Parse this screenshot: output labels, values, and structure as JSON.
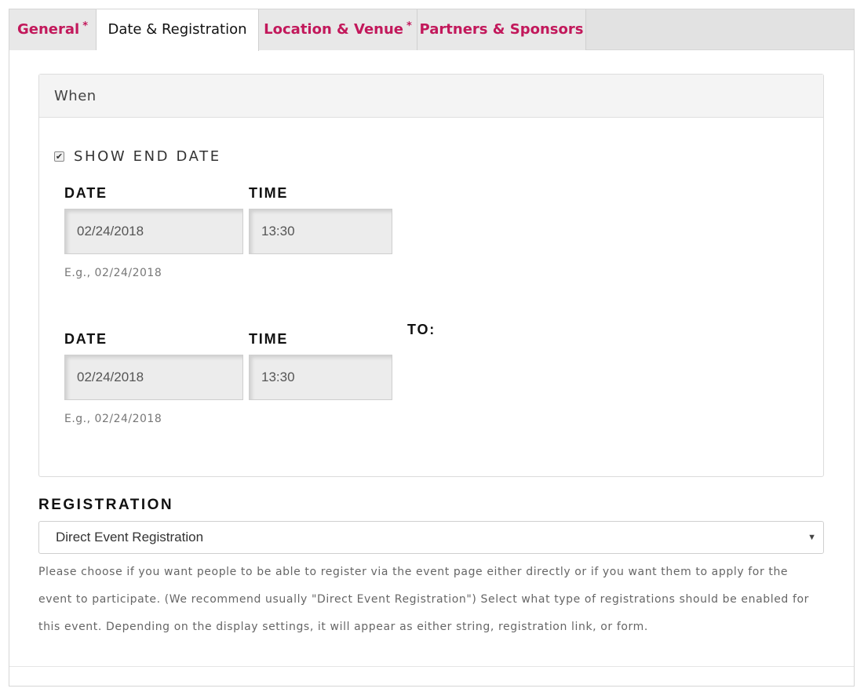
{
  "tabs": [
    {
      "label": "General",
      "required": "*"
    },
    {
      "label": "Date & Registration",
      "required": ""
    },
    {
      "label": "Location & Venue",
      "required": "*"
    },
    {
      "label": "Partners & Sponsors",
      "required": ""
    }
  ],
  "active_tab": "Date & Registration",
  "when": {
    "title": "When",
    "show_end_date": {
      "label": "SHOW END DATE",
      "checked": true
    },
    "start": {
      "date_label": "DATE",
      "time_label": "TIME",
      "date_value": "02/24/2018",
      "time_value": "13:30",
      "hint": "E.g., 02/24/2018"
    },
    "to_label": "TO:",
    "end": {
      "date_label": "DATE",
      "time_label": "TIME",
      "date_value": "02/24/2018",
      "time_value": "13:30",
      "hint": "E.g., 02/24/2018"
    }
  },
  "registration": {
    "label": "REGISTRATION",
    "selected": "Direct Event Registration",
    "description": "Please choose if you want people to be able to register via the event page either directly or if you want them to apply for the event to participate. (We recommend usually \"Direct Event Registration\") Select what type of registrations should be enabled for this event. Depending on the display settings, it will appear as either string, registration link, or form."
  },
  "colors": {
    "accent": "#c2185b",
    "tabbar": "#e2e2e2",
    "field": "#ececec"
  }
}
